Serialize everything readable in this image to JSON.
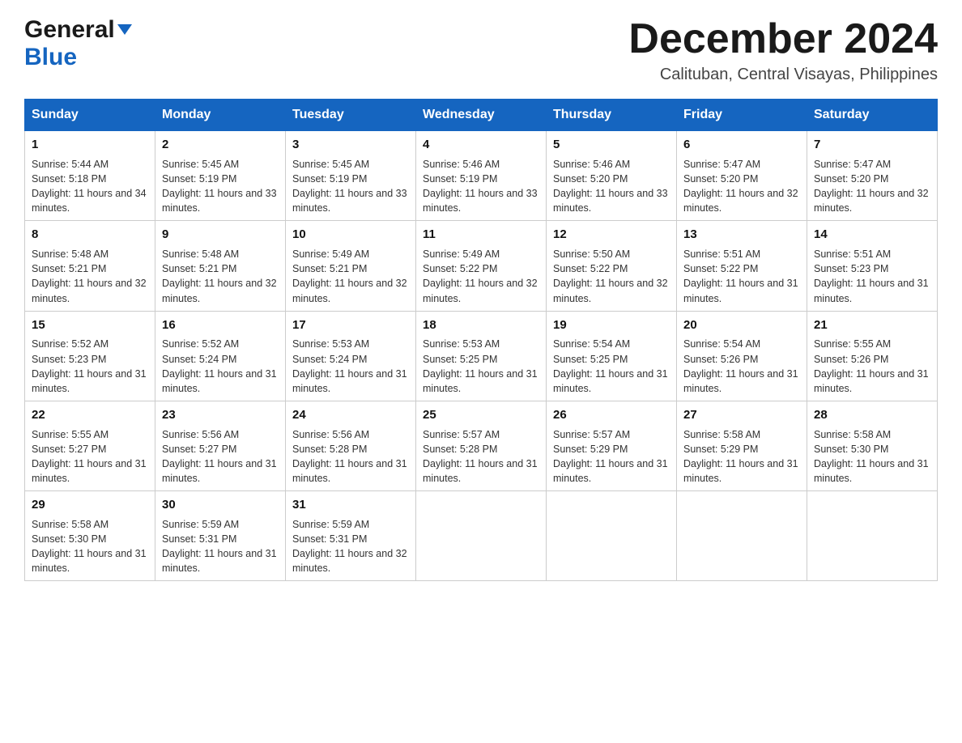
{
  "header": {
    "logo_general": "General",
    "logo_blue": "Blue",
    "month_title": "December 2024",
    "location": "Calituban, Central Visayas, Philippines"
  },
  "days_of_week": [
    "Sunday",
    "Monday",
    "Tuesday",
    "Wednesday",
    "Thursday",
    "Friday",
    "Saturday"
  ],
  "weeks": [
    [
      {
        "day": "1",
        "sunrise": "5:44 AM",
        "sunset": "5:18 PM",
        "daylight": "11 hours and 34 minutes."
      },
      {
        "day": "2",
        "sunrise": "5:45 AM",
        "sunset": "5:19 PM",
        "daylight": "11 hours and 33 minutes."
      },
      {
        "day": "3",
        "sunrise": "5:45 AM",
        "sunset": "5:19 PM",
        "daylight": "11 hours and 33 minutes."
      },
      {
        "day": "4",
        "sunrise": "5:46 AM",
        "sunset": "5:19 PM",
        "daylight": "11 hours and 33 minutes."
      },
      {
        "day": "5",
        "sunrise": "5:46 AM",
        "sunset": "5:20 PM",
        "daylight": "11 hours and 33 minutes."
      },
      {
        "day": "6",
        "sunrise": "5:47 AM",
        "sunset": "5:20 PM",
        "daylight": "11 hours and 32 minutes."
      },
      {
        "day": "7",
        "sunrise": "5:47 AM",
        "sunset": "5:20 PM",
        "daylight": "11 hours and 32 minutes."
      }
    ],
    [
      {
        "day": "8",
        "sunrise": "5:48 AM",
        "sunset": "5:21 PM",
        "daylight": "11 hours and 32 minutes."
      },
      {
        "day": "9",
        "sunrise": "5:48 AM",
        "sunset": "5:21 PM",
        "daylight": "11 hours and 32 minutes."
      },
      {
        "day": "10",
        "sunrise": "5:49 AM",
        "sunset": "5:21 PM",
        "daylight": "11 hours and 32 minutes."
      },
      {
        "day": "11",
        "sunrise": "5:49 AM",
        "sunset": "5:22 PM",
        "daylight": "11 hours and 32 minutes."
      },
      {
        "day": "12",
        "sunrise": "5:50 AM",
        "sunset": "5:22 PM",
        "daylight": "11 hours and 32 minutes."
      },
      {
        "day": "13",
        "sunrise": "5:51 AM",
        "sunset": "5:22 PM",
        "daylight": "11 hours and 31 minutes."
      },
      {
        "day": "14",
        "sunrise": "5:51 AM",
        "sunset": "5:23 PM",
        "daylight": "11 hours and 31 minutes."
      }
    ],
    [
      {
        "day": "15",
        "sunrise": "5:52 AM",
        "sunset": "5:23 PM",
        "daylight": "11 hours and 31 minutes."
      },
      {
        "day": "16",
        "sunrise": "5:52 AM",
        "sunset": "5:24 PM",
        "daylight": "11 hours and 31 minutes."
      },
      {
        "day": "17",
        "sunrise": "5:53 AM",
        "sunset": "5:24 PM",
        "daylight": "11 hours and 31 minutes."
      },
      {
        "day": "18",
        "sunrise": "5:53 AM",
        "sunset": "5:25 PM",
        "daylight": "11 hours and 31 minutes."
      },
      {
        "day": "19",
        "sunrise": "5:54 AM",
        "sunset": "5:25 PM",
        "daylight": "11 hours and 31 minutes."
      },
      {
        "day": "20",
        "sunrise": "5:54 AM",
        "sunset": "5:26 PM",
        "daylight": "11 hours and 31 minutes."
      },
      {
        "day": "21",
        "sunrise": "5:55 AM",
        "sunset": "5:26 PM",
        "daylight": "11 hours and 31 minutes."
      }
    ],
    [
      {
        "day": "22",
        "sunrise": "5:55 AM",
        "sunset": "5:27 PM",
        "daylight": "11 hours and 31 minutes."
      },
      {
        "day": "23",
        "sunrise": "5:56 AM",
        "sunset": "5:27 PM",
        "daylight": "11 hours and 31 minutes."
      },
      {
        "day": "24",
        "sunrise": "5:56 AM",
        "sunset": "5:28 PM",
        "daylight": "11 hours and 31 minutes."
      },
      {
        "day": "25",
        "sunrise": "5:57 AM",
        "sunset": "5:28 PM",
        "daylight": "11 hours and 31 minutes."
      },
      {
        "day": "26",
        "sunrise": "5:57 AM",
        "sunset": "5:29 PM",
        "daylight": "11 hours and 31 minutes."
      },
      {
        "day": "27",
        "sunrise": "5:58 AM",
        "sunset": "5:29 PM",
        "daylight": "11 hours and 31 minutes."
      },
      {
        "day": "28",
        "sunrise": "5:58 AM",
        "sunset": "5:30 PM",
        "daylight": "11 hours and 31 minutes."
      }
    ],
    [
      {
        "day": "29",
        "sunrise": "5:58 AM",
        "sunset": "5:30 PM",
        "daylight": "11 hours and 31 minutes."
      },
      {
        "day": "30",
        "sunrise": "5:59 AM",
        "sunset": "5:31 PM",
        "daylight": "11 hours and 31 minutes."
      },
      {
        "day": "31",
        "sunrise": "5:59 AM",
        "sunset": "5:31 PM",
        "daylight": "11 hours and 32 minutes."
      },
      null,
      null,
      null,
      null
    ]
  ],
  "labels": {
    "sunrise": "Sunrise:",
    "sunset": "Sunset:",
    "daylight": "Daylight:"
  }
}
